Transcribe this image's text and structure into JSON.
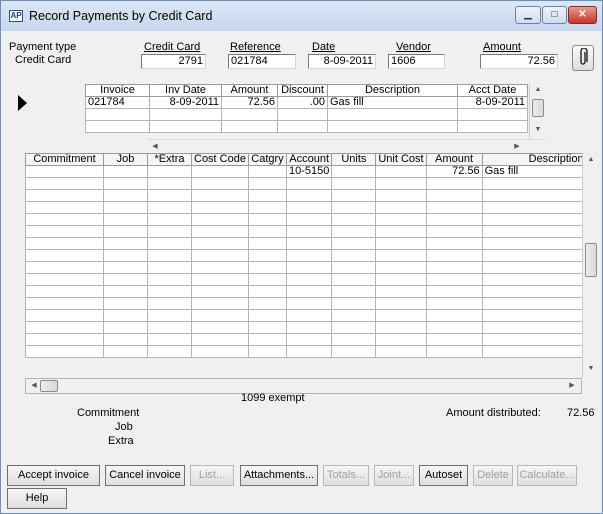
{
  "window": {
    "title": "Record Payments by Credit Card",
    "app_icon": "AP",
    "min": "▁",
    "max": "□",
    "close": "✕"
  },
  "header": {
    "payment_type_label": "Payment type",
    "payment_type_value": "Credit Card",
    "credit_card_label": "Credit Card",
    "credit_card_value": "2791",
    "reference_label": "Reference",
    "reference_value": "021784",
    "date_label": "Date",
    "date_value": "8-09-2011",
    "vendor_label": "Vendor",
    "vendor_value": "1606",
    "amount_label": "Amount",
    "amount_value": "72.56"
  },
  "invoice_grid": {
    "columns": [
      "Invoice",
      "Inv Date",
      "Amount",
      "Discount",
      "Description",
      "Acct Date"
    ],
    "rows": [
      [
        "021784",
        "8-09-2011",
        "72.56",
        ".00",
        "Gas fill",
        "8-09-2011"
      ],
      [
        "",
        "",
        "",
        "",
        "",
        ""
      ],
      [
        "",
        "",
        "",
        "",
        "",
        ""
      ]
    ]
  },
  "dist_grid": {
    "columns": [
      "Commitment",
      "Job",
      "*Extra",
      "Cost Code",
      "Catgry",
      "Account",
      "Units",
      "Unit Cost",
      "Amount",
      "Description"
    ],
    "rows": [
      [
        "",
        "",
        "",
        "",
        "",
        "10-5150",
        "",
        "",
        "72.56",
        "Gas fill"
      ]
    ]
  },
  "footer": {
    "exempt_label": "1099 exempt",
    "commitment_label": "Commitment",
    "job_label": "Job",
    "extra_label": "Extra",
    "amount_distributed_label": "Amount distributed:",
    "amount_distributed_value": "72.56"
  },
  "buttons": {
    "accept": "Accept invoice",
    "cancel": "Cancel invoice",
    "list": "List...",
    "attachments": "Attachments...",
    "totals": "Totals...",
    "joint": "Joint...",
    "autoset": "Autoset",
    "delete": "Delete",
    "calculate": "Calculate...",
    "help": "Help"
  },
  "icons": {
    "paperclip": "paperclip-icon",
    "row_marker": "row-pointer-icon",
    "scroll": "scroll-arrow-icon"
  }
}
